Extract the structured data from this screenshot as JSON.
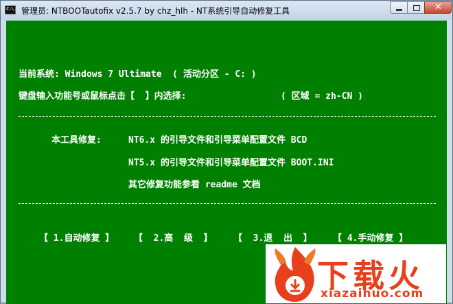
{
  "window": {
    "icon_text": "C:\\.",
    "title": "管理员:  NTBOOTautofix v2.5.7 by chz_hlh - NT系统引导自动修复工具"
  },
  "console": {
    "line_system": "当前系统: Windows 7 Ultimate  ( 活动分区 - C: )",
    "line_prompt": "键盘输入功能号或鼠标点击【  】内选择:",
    "line_region": "( 区域 = zh-CN )",
    "fix_label": "本工具修复:",
    "fix_nt6": "NT6.x 的引导文件和引导菜单配置文件 BCD",
    "fix_nt5": "NT5.x 的引导文件和引导菜单配置文件 BOOT.INI",
    "fix_other": "其它修复功能参看 readme 文档",
    "menu": [
      "【 1.自动修复 】",
      "【  2.高  级  】",
      "【  3.退  出  】",
      "【 4.手动修复 】"
    ]
  },
  "watermark": {
    "brand": "下载火",
    "domain": "xiazaihuo.com"
  },
  "colors": {
    "console_bg": "#008000",
    "console_text": "#ffffff",
    "watermark": "#e8401c"
  }
}
